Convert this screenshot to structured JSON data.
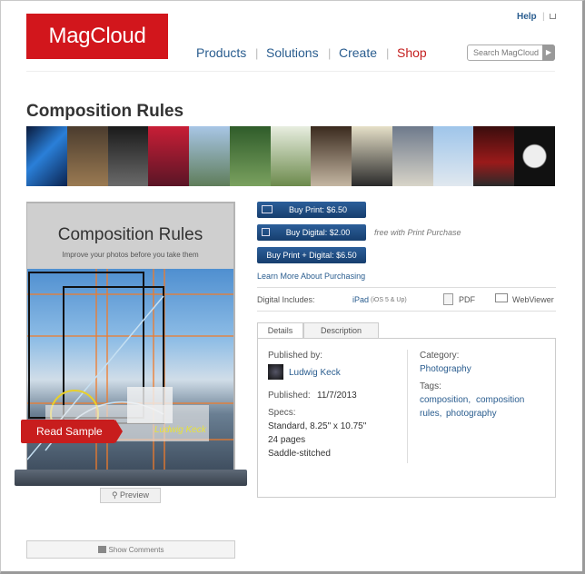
{
  "header": {
    "logo": "MagCloud",
    "help": "Help",
    "separator": "|",
    "nav": [
      "Products",
      "Solutions",
      "Create",
      "Shop"
    ],
    "search_placeholder": "Search MagCloud",
    "search_button": "▶"
  },
  "page": {
    "title": "Composition Rules"
  },
  "book": {
    "cover_title": "Composition Rules",
    "cover_subtitle": "Improve your photos before you take them",
    "read_sample": "Read Sample",
    "signature": "Ludwig Keck",
    "preview": "Preview"
  },
  "purchase": {
    "buy_print": "Buy Print: $6.50",
    "buy_digital": "Buy Digital: $2.00",
    "buy_both": "Buy Print + Digital: $6.50",
    "free_note": "free with Print Purchase",
    "learn_more": "Learn More About Purchasing",
    "digital_includes_label": "Digital Includes:",
    "ipad": "iPad",
    "ipad_note": "(iOS 5 & Up)",
    "pdf": "PDF",
    "webviewer": "WebViewer"
  },
  "tabs": {
    "details": "Details",
    "description": "Description"
  },
  "details": {
    "published_by_label": "Published by:",
    "author": "Ludwig Keck",
    "published_label": "Published:",
    "published_date": "11/7/2013",
    "specs_label": "Specs:",
    "specs_size": "Standard, 8.25\" x 10.75\"",
    "specs_pages": "24 pages",
    "specs_binding": "Saddle-stitched",
    "category_label": "Category:",
    "category": "Photography",
    "tags_label": "Tags:",
    "tags": [
      "composition,",
      "composition",
      "rules,",
      "photography"
    ]
  },
  "comments": {
    "show_comments": "Show Comments"
  },
  "colors": {
    "brand_red": "#d2161c",
    "link_blue": "#2a5d8f",
    "button_blue": "#1d4a80"
  }
}
